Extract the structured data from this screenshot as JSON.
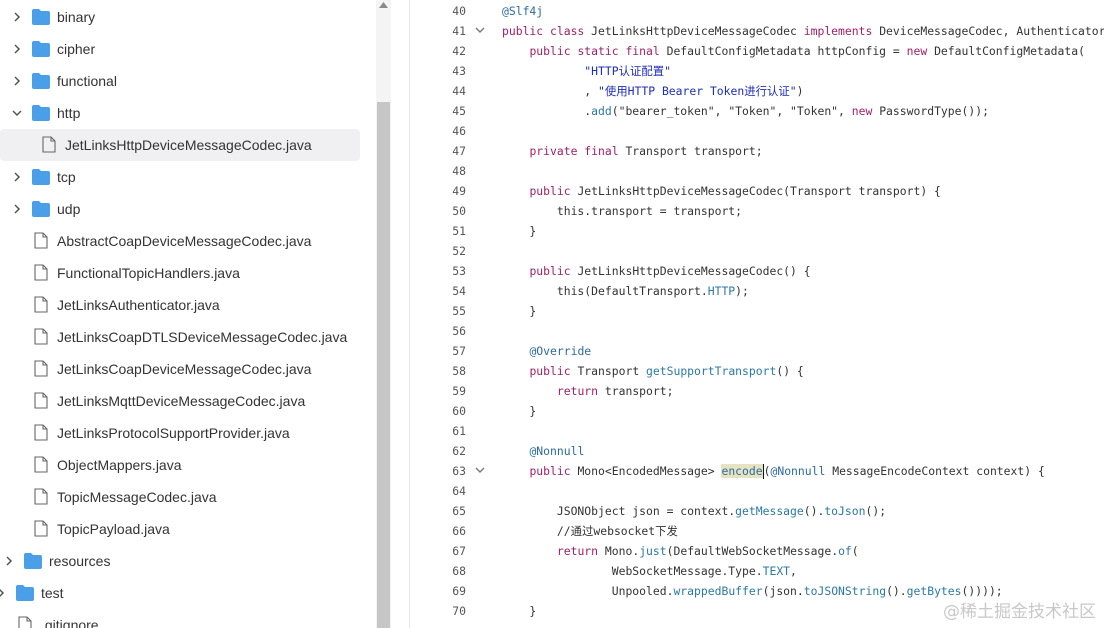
{
  "tree": [
    {
      "kind": "folder",
      "label": "binary",
      "expanded": false,
      "indent": 1
    },
    {
      "kind": "folder",
      "label": "cipher",
      "expanded": false,
      "indent": 1
    },
    {
      "kind": "folder",
      "label": "functional",
      "expanded": false,
      "indent": 1
    },
    {
      "kind": "folder",
      "label": "http",
      "expanded": true,
      "indent": 1
    },
    {
      "kind": "file",
      "label": "JetLinksHttpDeviceMessageCodec.java",
      "indent": 2,
      "selected": true
    },
    {
      "kind": "folder",
      "label": "tcp",
      "expanded": false,
      "indent": 1
    },
    {
      "kind": "folder",
      "label": "udp",
      "expanded": false,
      "indent": 1
    },
    {
      "kind": "file",
      "label": "AbstractCoapDeviceMessageCodec.java",
      "indent": 1
    },
    {
      "kind": "file",
      "label": "FunctionalTopicHandlers.java",
      "indent": 1
    },
    {
      "kind": "file",
      "label": "JetLinksAuthenticator.java",
      "indent": 1
    },
    {
      "kind": "file",
      "label": "JetLinksCoapDTLSDeviceMessageCodec.java",
      "indent": 1
    },
    {
      "kind": "file",
      "label": "JetLinksCoapDeviceMessageCodec.java",
      "indent": 1
    },
    {
      "kind": "file",
      "label": "JetLinksMqttDeviceMessageCodec.java",
      "indent": 1
    },
    {
      "kind": "file",
      "label": "JetLinksProtocolSupportProvider.java",
      "indent": 1
    },
    {
      "kind": "file",
      "label": "ObjectMappers.java",
      "indent": 1
    },
    {
      "kind": "file",
      "label": "TopicMessageCodec.java",
      "indent": 1
    },
    {
      "kind": "file",
      "label": "TopicPayload.java",
      "indent": 1
    },
    {
      "kind": "folder",
      "label": "resources",
      "expanded": false,
      "indent": 0
    },
    {
      "kind": "folder",
      "label": "test",
      "expanded": false,
      "indent": -1
    },
    {
      "kind": "file",
      "label": ".gitignore",
      "indent": -1
    }
  ],
  "colors": {
    "folder": "#4a9fe6",
    "selected_bg": "#f0f0f2",
    "keyword": "#9f1f6a",
    "annotation": "#2c6a9e",
    "string": "#1d2db8"
  },
  "code_lines": [
    {
      "n": "40",
      "fold": false,
      "toks": [
        [
          "ann",
          "@Slf4j"
        ]
      ]
    },
    {
      "n": "41",
      "fold": true,
      "toks": [
        [
          "kw",
          "public class "
        ],
        [
          "plain",
          "JetLinksHttpDeviceMessageCodec "
        ],
        [
          "kw",
          "implements "
        ],
        [
          "plain",
          "DeviceMessageCodec, Authenticator {"
        ]
      ]
    },
    {
      "n": "42",
      "fold": false,
      "toks": [
        [
          "plain",
          "    "
        ],
        [
          "kw",
          "public static final "
        ],
        [
          "plain",
          "DefaultConfigMetadata httpConfig = "
        ],
        [
          "kw",
          "new "
        ],
        [
          "plain",
          "DefaultConfigMetadata("
        ]
      ]
    },
    {
      "n": "43",
      "fold": false,
      "toks": [
        [
          "plain",
          "            "
        ],
        [
          "str",
          "\"HTTP认证配置\""
        ]
      ]
    },
    {
      "n": "44",
      "fold": false,
      "toks": [
        [
          "plain",
          "            , "
        ],
        [
          "str",
          "\"使用HTTP Bearer Token进行认证\""
        ],
        [
          "plain",
          ")"
        ]
      ]
    },
    {
      "n": "45",
      "fold": false,
      "toks": [
        [
          "plain",
          "            ."
        ],
        [
          "fn",
          "add"
        ],
        [
          "plain",
          "(\"bearer_token\", \"Token\", \"Token\", "
        ],
        [
          "kw",
          "new "
        ],
        [
          "plain",
          "PasswordType());"
        ]
      ]
    },
    {
      "n": "46",
      "fold": false,
      "toks": []
    },
    {
      "n": "47",
      "fold": false,
      "toks": [
        [
          "plain",
          "    "
        ],
        [
          "kw",
          "private final "
        ],
        [
          "plain",
          "Transport transport;"
        ]
      ]
    },
    {
      "n": "48",
      "fold": false,
      "toks": []
    },
    {
      "n": "49",
      "fold": false,
      "toks": [
        [
          "plain",
          "    "
        ],
        [
          "kw",
          "public "
        ],
        [
          "plain",
          "JetLinksHttpDeviceMessageCodec(Transport transport) {"
        ]
      ]
    },
    {
      "n": "50",
      "fold": false,
      "toks": [
        [
          "plain",
          "        this.transport = transport;"
        ]
      ]
    },
    {
      "n": "51",
      "fold": false,
      "toks": [
        [
          "plain",
          "    }"
        ]
      ]
    },
    {
      "n": "52",
      "fold": false,
      "toks": []
    },
    {
      "n": "53",
      "fold": false,
      "toks": [
        [
          "plain",
          "    "
        ],
        [
          "kw",
          "public "
        ],
        [
          "plain",
          "JetLinksHttpDeviceMessageCodec() {"
        ]
      ]
    },
    {
      "n": "54",
      "fold": false,
      "toks": [
        [
          "plain",
          "        this(DefaultTransport."
        ],
        [
          "fn",
          "HTTP"
        ],
        [
          "plain",
          ");"
        ]
      ]
    },
    {
      "n": "55",
      "fold": false,
      "toks": [
        [
          "plain",
          "    }"
        ]
      ]
    },
    {
      "n": "56",
      "fold": false,
      "toks": []
    },
    {
      "n": "57",
      "fold": false,
      "toks": [
        [
          "plain",
          "    "
        ],
        [
          "ann",
          "@Override"
        ]
      ]
    },
    {
      "n": "58",
      "fold": false,
      "toks": [
        [
          "plain",
          "    "
        ],
        [
          "kw",
          "public "
        ],
        [
          "plain",
          "Transport "
        ],
        [
          "fn",
          "getSupportTransport"
        ],
        [
          "plain",
          "() {"
        ]
      ]
    },
    {
      "n": "59",
      "fold": false,
      "toks": [
        [
          "plain",
          "        "
        ],
        [
          "kw",
          "return "
        ],
        [
          "plain",
          "transport;"
        ]
      ]
    },
    {
      "n": "60",
      "fold": false,
      "toks": [
        [
          "plain",
          "    }"
        ]
      ]
    },
    {
      "n": "61",
      "fold": false,
      "toks": []
    },
    {
      "n": "62",
      "fold": false,
      "toks": [
        [
          "plain",
          "    "
        ],
        [
          "ann",
          "@Nonnull"
        ]
      ]
    },
    {
      "n": "63",
      "fold": true,
      "toks": [
        [
          "plain",
          "    "
        ],
        [
          "kw",
          "public "
        ],
        [
          "plain",
          "Mono<EncodedMessage> "
        ],
        [
          "hl",
          "encode"
        ],
        [
          "caret",
          ""
        ],
        [
          "plain",
          "("
        ],
        [
          "ann",
          "@Nonnull"
        ],
        [
          "plain",
          " MessageEncodeContext context) {"
        ]
      ]
    },
    {
      "n": "64",
      "fold": false,
      "toks": []
    },
    {
      "n": "65",
      "fold": false,
      "toks": [
        [
          "plain",
          "        JSONObject json = context."
        ],
        [
          "fn",
          "getMessage"
        ],
        [
          "plain",
          "()."
        ],
        [
          "fn",
          "toJson"
        ],
        [
          "plain",
          "();"
        ]
      ]
    },
    {
      "n": "66",
      "fold": false,
      "toks": [
        [
          "plain",
          "        "
        ],
        [
          "cm",
          "//通过websocket下发"
        ]
      ]
    },
    {
      "n": "67",
      "fold": false,
      "toks": [
        [
          "plain",
          "        "
        ],
        [
          "kw",
          "return "
        ],
        [
          "plain",
          "Mono."
        ],
        [
          "fn",
          "just"
        ],
        [
          "plain",
          "(DefaultWebSocketMessage."
        ],
        [
          "fn",
          "of"
        ],
        [
          "plain",
          "("
        ]
      ]
    },
    {
      "n": "68",
      "fold": false,
      "toks": [
        [
          "plain",
          "                WebSocketMessage.Type."
        ],
        [
          "fn",
          "TEXT"
        ],
        [
          "plain",
          ","
        ]
      ]
    },
    {
      "n": "69",
      "fold": false,
      "toks": [
        [
          "plain",
          "                Unpooled."
        ],
        [
          "fn",
          "wrappedBuffer"
        ],
        [
          "plain",
          "(json."
        ],
        [
          "fn",
          "toJSONString"
        ],
        [
          "plain",
          "()."
        ],
        [
          "fn",
          "getBytes"
        ],
        [
          "plain",
          "())));"
        ]
      ]
    },
    {
      "n": "70",
      "fold": false,
      "toks": [
        [
          "plain",
          "    }"
        ]
      ]
    }
  ],
  "watermark": "@稀土掘金技术社区"
}
